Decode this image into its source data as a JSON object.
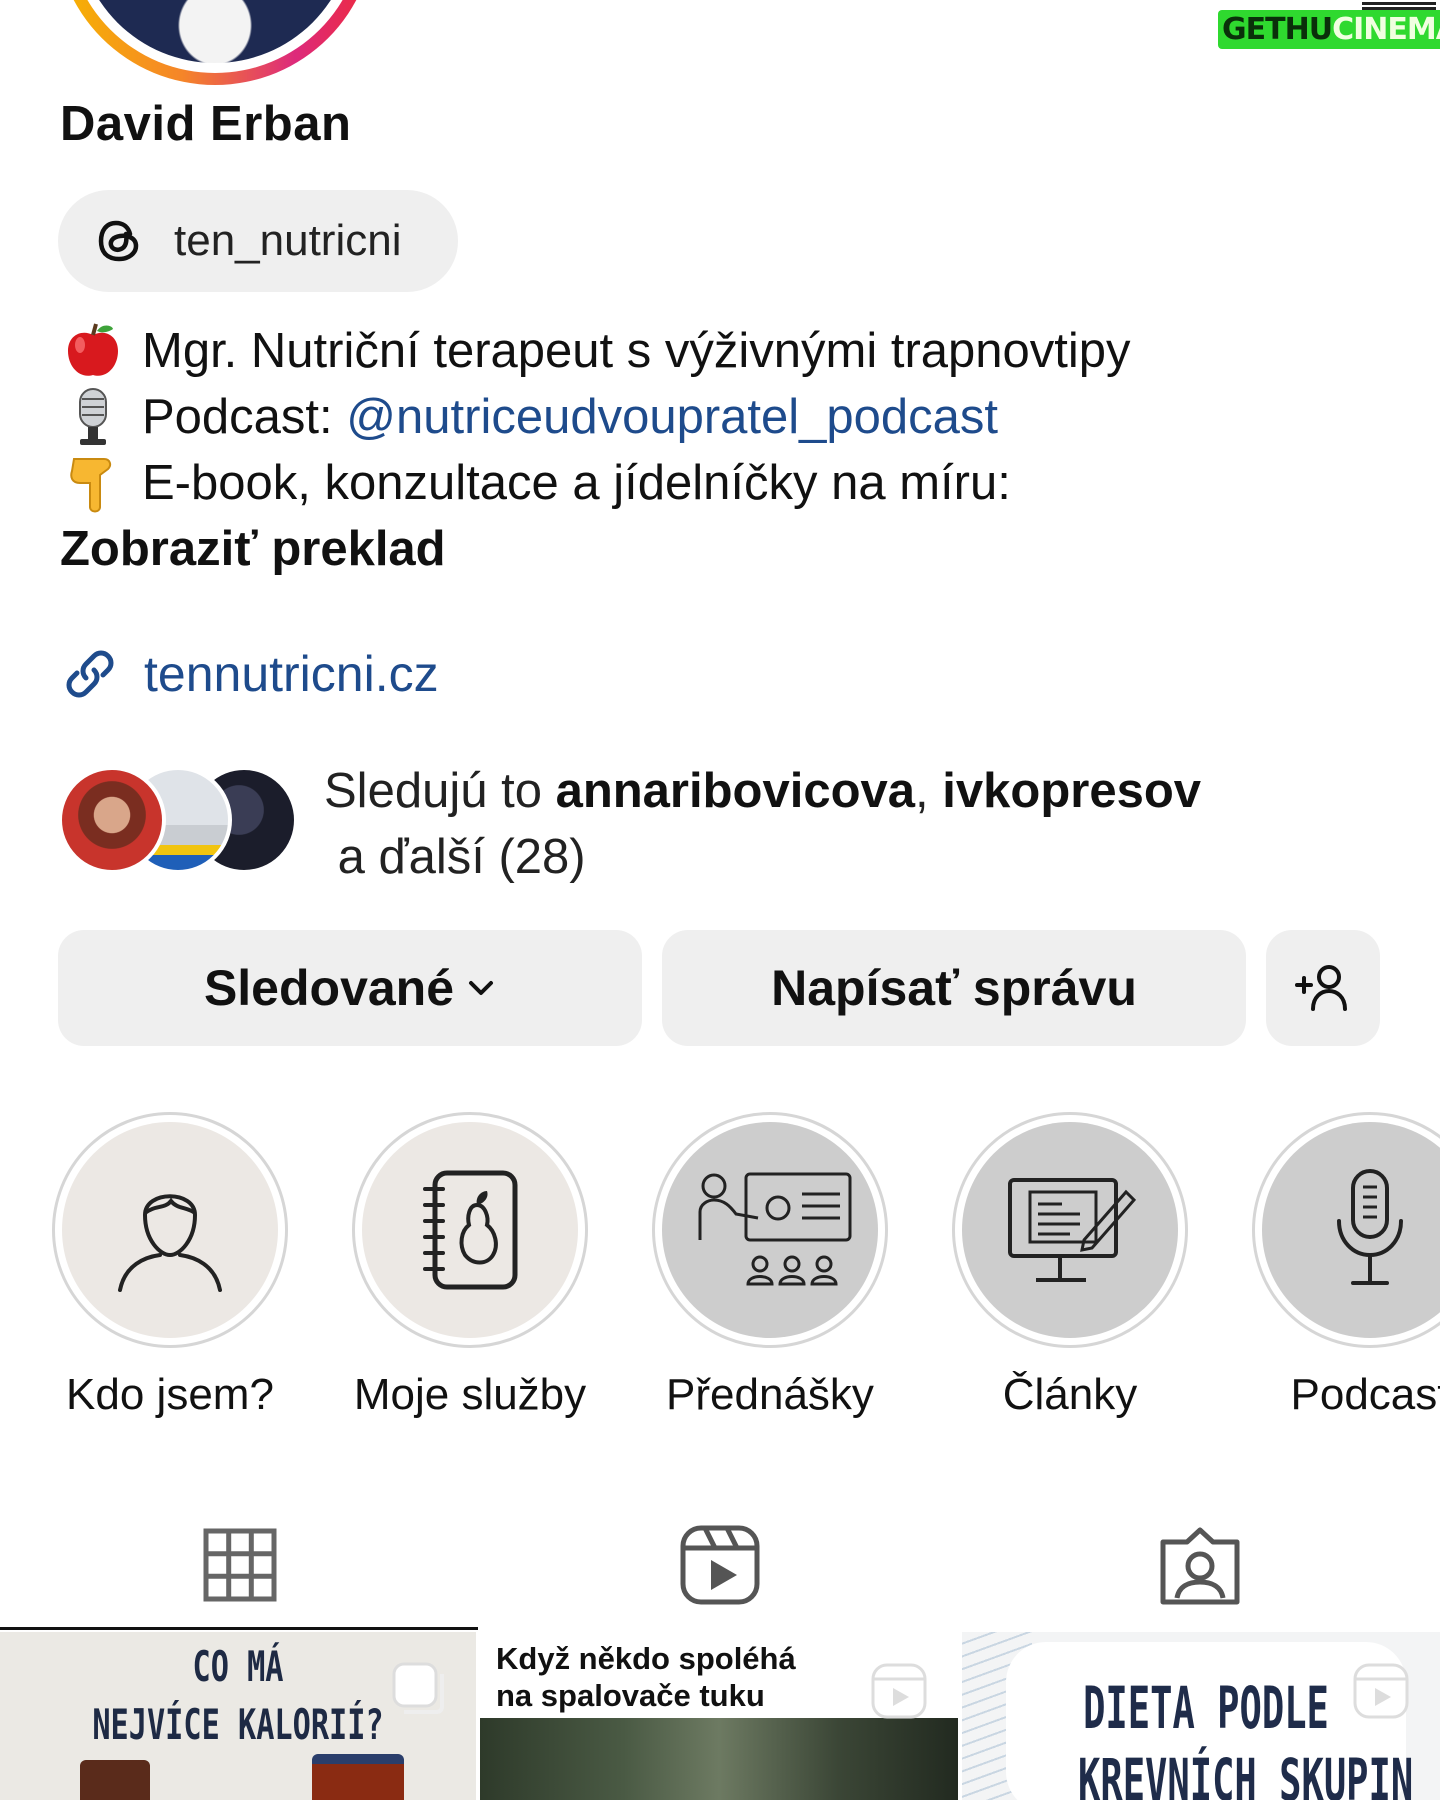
{
  "profile": {
    "name": "David Erban",
    "threads_handle": "ten_nutricni",
    "bio_lines": [
      {
        "emoji": "apple",
        "text": "Mgr. Nutriční terapeut s výživnými trapnovtipy"
      },
      {
        "emoji": "microphone",
        "prefix": "Podcast: ",
        "mention": "@nutriceudvoupratel_podcast"
      },
      {
        "emoji": "pointing-down",
        "text": "E-book, konzultace a jídelníčky na míru:"
      }
    ],
    "translate_label": "Zobraziť preklad",
    "website": "tennutricni.cz",
    "followed_by": {
      "prefix": "Sledujú to ",
      "user1": "annaribovicova",
      "separator": ", ",
      "user2": "ivkopresov",
      "suffix": " a ďalší (28)"
    }
  },
  "watermark": {
    "part1": "GETHU",
    "part2": "CINEMA"
  },
  "actions": {
    "following_label": "Sledované",
    "message_label": "Napísať správu",
    "add_user_icon": "add-user-icon"
  },
  "highlights": [
    {
      "label": "Kdo jsem?",
      "icon": "person-icon"
    },
    {
      "label": "Moje služby",
      "icon": "notebook-pear-icon"
    },
    {
      "label": "Přednášky",
      "icon": "lecture-icon"
    },
    {
      "label": "Články",
      "icon": "articles-icon"
    },
    {
      "label": "Podcast",
      "icon": "microphone-icon"
    }
  ],
  "tabs": [
    {
      "icon": "grid-icon",
      "active": true
    },
    {
      "icon": "reels-icon",
      "active": false
    },
    {
      "icon": "tagged-icon",
      "active": false
    }
  ],
  "posts": [
    {
      "title_line1": "CO MÁ",
      "title_line2": "NEJVÍCE KALORIÍ?",
      "type": "carousel"
    },
    {
      "title_line1": "Když někdo spoléhá",
      "title_line2": "na spalovače tuku",
      "type": "reel"
    },
    {
      "title_line1": "DIETA PODLE",
      "title_line2": "KREVNÍCH SKUPIN",
      "type": "reel"
    }
  ],
  "colors": {
    "link": "#1e4b8c",
    "button_bg": "#efefef",
    "text": "#111111"
  }
}
